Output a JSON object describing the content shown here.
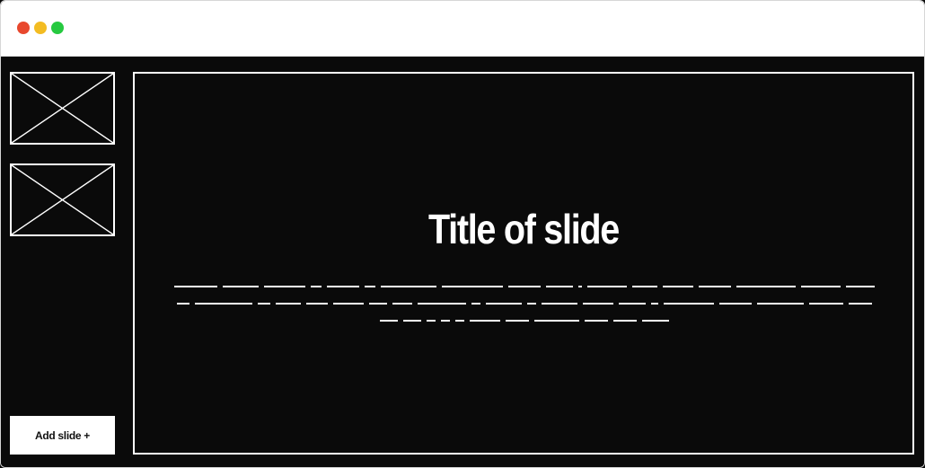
{
  "window": {
    "controls": [
      "close",
      "minimize",
      "maximize"
    ],
    "colors": {
      "close": "#e8482e",
      "minimize": "#f3bc22",
      "maximize": "#26c940",
      "background": "#0a0a0a",
      "foreground": "#ffffff"
    }
  },
  "sidebar": {
    "thumbnails": [
      {
        "icon": "image-placeholder-icon"
      },
      {
        "icon": "image-placeholder-icon"
      }
    ],
    "add_button_label": "Add slide +"
  },
  "slide": {
    "title": "Title of slide",
    "body_placeholder_lines": 3
  }
}
